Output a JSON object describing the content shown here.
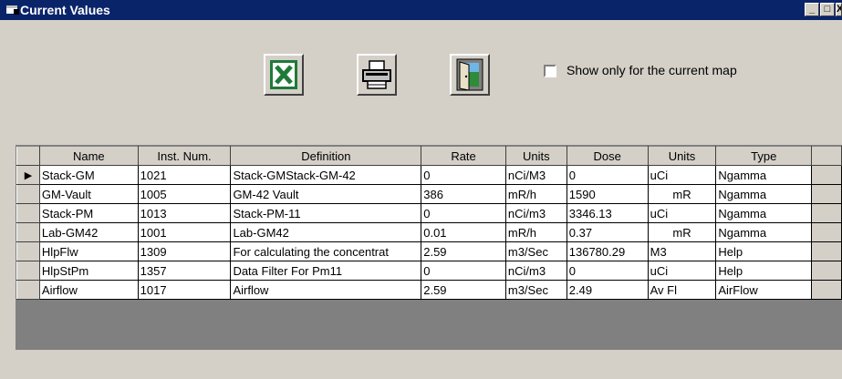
{
  "window": {
    "title": "Current Values",
    "controls": {
      "minimize": "_",
      "maximize": "□",
      "close": "X"
    }
  },
  "toolbar": {
    "buttons": [
      {
        "name": "excel",
        "icon": "excel-icon"
      },
      {
        "name": "print",
        "icon": "printer-icon"
      },
      {
        "name": "exit",
        "icon": "door-exit-icon"
      }
    ]
  },
  "filter": {
    "show_current_map_label": "Show only for the current map",
    "checked": false
  },
  "table": {
    "columns": [
      "Name",
      "Inst. Num.",
      "Definition",
      "Rate",
      "Units",
      "Dose",
      "Units",
      "Type"
    ],
    "rows": [
      {
        "name": "Stack-GM",
        "inst": "1021",
        "definition": "Stack-GMStack-GM-42",
        "rate": "0",
        "units1": "nCi/M3",
        "dose": "0",
        "units2": "uCi",
        "type": "Ngamma",
        "selected": true
      },
      {
        "name": "GM-Vault",
        "inst": "1005",
        "definition": "GM-42 Vault",
        "rate": "386",
        "units1": "mR/h",
        "dose": "1590",
        "units2": "mR",
        "type": "Ngamma"
      },
      {
        "name": "Stack-PM",
        "inst": "1013",
        "definition": "Stack-PM-11",
        "rate": "0",
        "units1": "nCi/m3",
        "dose": "3346.13",
        "units2": "uCi",
        "type": "Ngamma"
      },
      {
        "name": "Lab-GM42",
        "inst": "1001",
        "definition": "Lab-GM42",
        "rate": "0.01",
        "units1": "mR/h",
        "dose": "0.37",
        "units2": "mR",
        "type": "Ngamma"
      },
      {
        "name": "HlpFlw",
        "inst": "1309",
        "definition": "For calculating the concentrat",
        "rate": "2.59",
        "units1": "m3/Sec",
        "dose": "136780.29",
        "units2": "M3",
        "type": "Help"
      },
      {
        "name": "HlpStPm",
        "inst": "1357",
        "definition": "Data  Filter For Pm11",
        "rate": "0",
        "units1": "nCi/m3",
        "dose": "0",
        "units2": "uCi",
        "type": "Help"
      },
      {
        "name": "Airflow",
        "inst": "1017",
        "definition": "Airflow",
        "rate": "2.59",
        "units1": "m3/Sec",
        "dose": "2.49",
        "units2": "Av Fl",
        "type": "AirFlow"
      }
    ],
    "selector_glyph": "▶"
  }
}
